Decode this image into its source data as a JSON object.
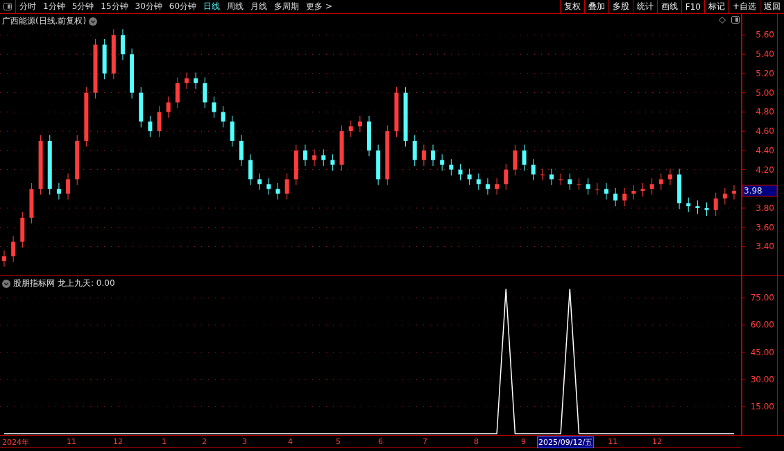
{
  "toolbar": {
    "periods": [
      {
        "label": "分时",
        "selected": false
      },
      {
        "label": "1分钟",
        "selected": false
      },
      {
        "label": "5分钟",
        "selected": false
      },
      {
        "label": "15分钟",
        "selected": false
      },
      {
        "label": "30分钟",
        "selected": false
      },
      {
        "label": "60分钟",
        "selected": false
      },
      {
        "label": "日线",
        "selected": true
      },
      {
        "label": "周线",
        "selected": false
      },
      {
        "label": "月线",
        "selected": false
      },
      {
        "label": "多周期",
        "selected": false
      }
    ],
    "more": "更多 >",
    "actions": [
      "复权",
      "叠加",
      "多股",
      "统计",
      "画线",
      "F10",
      "标记",
      "+自选",
      "返回"
    ]
  },
  "main_chart": {
    "title": "广西能源(日线.前复权)",
    "price_badge": "3.98",
    "chart_data": {
      "type": "candlestick",
      "grid": true,
      "ylim": [
        3.1,
        5.82
      ],
      "yticks": [
        {
          "value": 3.4,
          "label": "3.40"
        },
        {
          "value": 3.6,
          "label": "3.60"
        },
        {
          "value": 3.8,
          "label": "3.80"
        },
        {
          "value": 4.2,
          "label": "4.20"
        },
        {
          "value": 4.4,
          "label": "4.40"
        },
        {
          "value": 4.6,
          "label": "4.60"
        },
        {
          "value": 4.8,
          "label": "4.80"
        },
        {
          "value": 5.0,
          "label": "5.00"
        },
        {
          "value": 5.2,
          "label": "5.20"
        },
        {
          "value": 5.4,
          "label": "5.40"
        },
        {
          "value": 5.6,
          "label": "5.60"
        }
      ],
      "ohlc": [
        [
          3.25,
          3.36,
          3.19,
          3.3
        ],
        [
          3.3,
          3.51,
          3.24,
          3.45
        ],
        [
          3.45,
          3.76,
          3.39,
          3.7
        ],
        [
          3.7,
          4.06,
          3.64,
          4.0
        ],
        [
          4.0,
          4.56,
          3.94,
          4.5
        ],
        [
          4.5,
          4.56,
          3.94,
          4.0
        ],
        [
          4.0,
          4.06,
          3.89,
          3.95
        ],
        [
          3.95,
          4.16,
          3.89,
          4.1
        ],
        [
          4.1,
          4.56,
          4.04,
          4.5
        ],
        [
          4.5,
          5.06,
          4.44,
          5.0
        ],
        [
          5.0,
          5.56,
          4.94,
          5.5
        ],
        [
          5.5,
          5.56,
          5.14,
          5.2
        ],
        [
          5.2,
          5.66,
          5.14,
          5.6
        ],
        [
          5.6,
          5.66,
          5.34,
          5.4
        ],
        [
          5.4,
          5.46,
          4.94,
          5.0
        ],
        [
          5.0,
          5.06,
          4.64,
          4.7
        ],
        [
          4.7,
          4.76,
          4.54,
          4.6
        ],
        [
          4.6,
          4.86,
          4.54,
          4.8
        ],
        [
          4.8,
          4.96,
          4.74,
          4.9
        ],
        [
          4.9,
          5.16,
          4.84,
          5.1
        ],
        [
          5.1,
          5.21,
          5.04,
          5.15
        ],
        [
          5.15,
          5.21,
          5.04,
          5.1
        ],
        [
          5.1,
          5.16,
          4.84,
          4.9
        ],
        [
          4.9,
          4.96,
          4.74,
          4.8
        ],
        [
          4.8,
          4.86,
          4.64,
          4.7
        ],
        [
          4.7,
          4.76,
          4.44,
          4.5
        ],
        [
          4.5,
          4.56,
          4.24,
          4.3
        ],
        [
          4.3,
          4.36,
          4.04,
          4.1
        ],
        [
          4.1,
          4.16,
          3.99,
          4.05
        ],
        [
          4.05,
          4.11,
          3.94,
          4.0
        ],
        [
          4.0,
          4.06,
          3.89,
          3.95
        ],
        [
          3.95,
          4.16,
          3.89,
          4.1
        ],
        [
          4.1,
          4.46,
          4.04,
          4.4
        ],
        [
          4.4,
          4.46,
          4.24,
          4.3
        ],
        [
          4.3,
          4.41,
          4.24,
          4.35
        ],
        [
          4.35,
          4.41,
          4.24,
          4.3
        ],
        [
          4.3,
          4.36,
          4.19,
          4.25
        ],
        [
          4.25,
          4.66,
          4.19,
          4.6
        ],
        [
          4.6,
          4.71,
          4.54,
          4.65
        ],
        [
          4.65,
          4.76,
          4.59,
          4.7
        ],
        [
          4.7,
          4.76,
          4.34,
          4.4
        ],
        [
          4.4,
          4.46,
          4.04,
          4.1
        ],
        [
          4.1,
          4.66,
          4.04,
          4.6
        ],
        [
          4.6,
          5.06,
          4.54,
          5.0
        ],
        [
          5.0,
          5.06,
          4.44,
          4.5
        ],
        [
          4.5,
          4.56,
          4.24,
          4.3
        ],
        [
          4.3,
          4.46,
          4.24,
          4.4
        ],
        [
          4.4,
          4.46,
          4.24,
          4.3
        ],
        [
          4.3,
          4.36,
          4.19,
          4.25
        ],
        [
          4.25,
          4.31,
          4.14,
          4.2
        ],
        [
          4.2,
          4.26,
          4.09,
          4.15
        ],
        [
          4.15,
          4.21,
          4.04,
          4.1
        ],
        [
          4.1,
          4.16,
          3.99,
          4.05
        ],
        [
          4.05,
          4.11,
          3.94,
          4.0
        ],
        [
          4.0,
          4.11,
          3.94,
          4.05
        ],
        [
          4.05,
          4.26,
          3.99,
          4.2
        ],
        [
          4.2,
          4.46,
          4.14,
          4.4
        ],
        [
          4.4,
          4.46,
          4.19,
          4.25
        ],
        [
          4.25,
          4.31,
          4.09,
          4.15
        ],
        [
          4.15,
          4.21,
          4.09,
          4.15
        ],
        [
          4.15,
          4.21,
          4.04,
          4.1
        ],
        [
          4.1,
          4.16,
          4.04,
          4.1
        ],
        [
          4.1,
          4.16,
          3.99,
          4.05
        ],
        [
          4.05,
          4.11,
          3.99,
          4.05
        ],
        [
          4.05,
          4.11,
          3.94,
          4.0
        ],
        [
          4.0,
          4.06,
          3.94,
          4.0
        ],
        [
          4.0,
          4.06,
          3.89,
          3.95
        ],
        [
          3.95,
          4.01,
          3.82,
          3.88
        ],
        [
          3.88,
          4.01,
          3.82,
          3.95
        ],
        [
          3.95,
          4.04,
          3.89,
          3.98
        ],
        [
          3.98,
          4.06,
          3.92,
          4.0
        ],
        [
          4.0,
          4.11,
          3.94,
          4.05
        ],
        [
          4.05,
          4.16,
          3.99,
          4.1
        ],
        [
          4.1,
          4.21,
          4.04,
          4.15
        ],
        [
          4.15,
          4.21,
          3.79,
          3.85
        ],
        [
          3.85,
          3.91,
          3.76,
          3.82
        ],
        [
          3.82,
          3.88,
          3.74,
          3.8
        ],
        [
          3.8,
          3.86,
          3.72,
          3.78
        ],
        [
          3.78,
          3.96,
          3.72,
          3.9
        ],
        [
          3.9,
          4.01,
          3.84,
          3.95
        ],
        [
          3.95,
          4.04,
          3.89,
          3.98
        ]
      ]
    }
  },
  "indicator": {
    "source": "股朋指标网",
    "reading": ": 0.00",
    "chart_data": {
      "type": "line",
      "grid": true,
      "ylim": [
        0,
        87
      ],
      "yticks": [
        {
          "value": 15,
          "label": "15.00"
        },
        {
          "value": 30,
          "label": "30.00"
        },
        {
          "value": 45,
          "label": "45.00"
        },
        {
          "value": 60,
          "label": "60.00"
        },
        {
          "value": 75,
          "label": "75.00"
        }
      ],
      "series": [
        {
          "name": "龙上九天",
          "color": "#ffffff",
          "values": [
            0,
            0,
            0,
            0,
            0,
            0,
            0,
            0,
            0,
            0,
            0,
            0,
            0,
            0,
            0,
            0,
            0,
            0,
            0,
            0,
            0,
            0,
            0,
            0,
            0,
            0,
            0,
            0,
            0,
            0,
            0,
            0,
            0,
            0,
            0,
            0,
            0,
            0,
            0,
            0,
            0,
            0,
            0,
            0,
            0,
            0,
            0,
            0,
            0,
            0,
            0,
            0,
            0,
            0,
            0,
            80,
            0,
            0,
            0,
            0,
            0,
            0,
            80,
            0,
            0,
            0,
            0,
            0,
            0,
            0,
            0,
            0,
            0,
            0,
            0,
            0,
            0,
            0,
            0,
            0,
            0
          ]
        }
      ]
    }
  },
  "date_axis": [
    {
      "label": "2024年",
      "highlighted": false
    },
    {
      "label": "11",
      "highlighted": false
    },
    {
      "label": "12",
      "highlighted": false
    },
    {
      "label": "1",
      "highlighted": false
    },
    {
      "label": "2",
      "highlighted": false
    },
    {
      "label": "3",
      "highlighted": false
    },
    {
      "label": "4",
      "highlighted": false
    },
    {
      "label": "5",
      "highlighted": false
    },
    {
      "label": "6",
      "highlighted": false
    },
    {
      "label": "7",
      "highlighted": false
    },
    {
      "label": "8",
      "highlighted": false
    },
    {
      "label": "9",
      "highlighted": false
    },
    {
      "label": "2025/09/12/五",
      "highlighted": true
    },
    {
      "label": "11",
      "highlighted": false
    },
    {
      "label": "12",
      "highlighted": false
    }
  ]
}
